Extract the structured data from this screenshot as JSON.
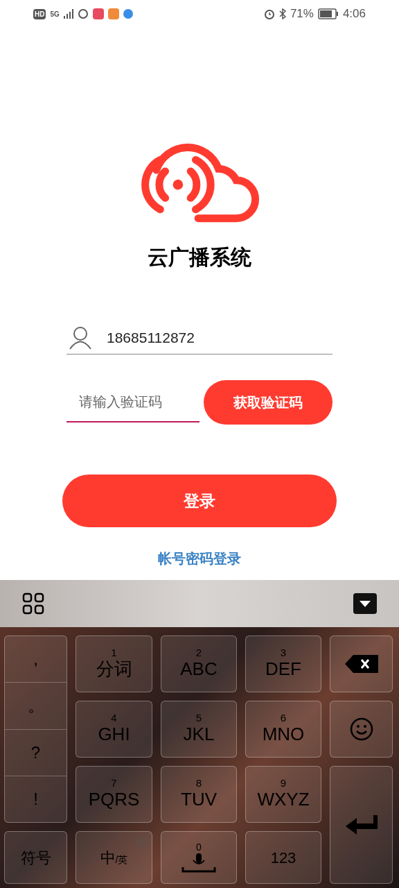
{
  "status_bar": {
    "network_badges": [
      "HD",
      "5G"
    ],
    "battery": "71%",
    "time": "4:06"
  },
  "app": {
    "title": "云广播系统"
  },
  "form": {
    "phone": {
      "value": "18685112872"
    },
    "code": {
      "placeholder": "请输入验证码",
      "focused": true
    },
    "get_code_button": "获取验证码",
    "login_button": "登录",
    "alt_login_link": "帐号密码登录"
  },
  "keyboard": {
    "punctuation": [
      ",",
      "。",
      "?",
      "!"
    ],
    "keys": [
      {
        "kind": "letter",
        "digit": "1",
        "label": "分词"
      },
      {
        "kind": "letter",
        "digit": "2",
        "label": "ABC"
      },
      {
        "kind": "letter",
        "digit": "3",
        "label": "DEF"
      },
      {
        "kind": "backspace"
      },
      {
        "kind": "letter",
        "digit": "4",
        "label": "GHI"
      },
      {
        "kind": "letter",
        "digit": "5",
        "label": "JKL"
      },
      {
        "kind": "letter",
        "digit": "6",
        "label": "MNO"
      },
      {
        "kind": "emoji"
      },
      {
        "kind": "letter",
        "digit": "7",
        "label": "PQRS"
      },
      {
        "kind": "letter",
        "digit": "8",
        "label": "TUV"
      },
      {
        "kind": "letter",
        "digit": "9",
        "label": "WXYZ"
      },
      {
        "kind": "enter"
      }
    ],
    "bottom_row": [
      {
        "kind": "text",
        "label": "符号"
      },
      {
        "kind": "lang",
        "label": "中",
        "sub": "/英"
      },
      {
        "kind": "voice",
        "digit": "0"
      },
      {
        "kind": "text",
        "label": "123"
      }
    ]
  }
}
